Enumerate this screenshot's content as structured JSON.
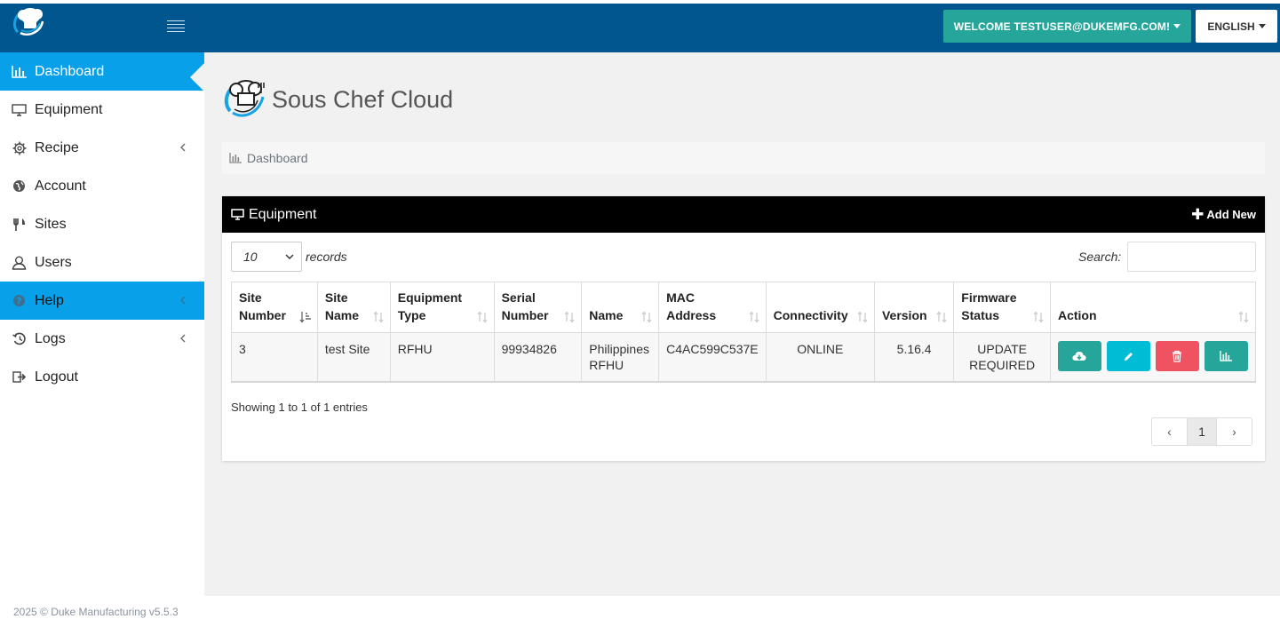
{
  "app": {
    "name": "Sous Chef Cloud"
  },
  "header": {
    "welcome_label": "WELCOME TESTUSER@DUKEMFG.COM!",
    "language_label": "ENGLISH"
  },
  "sidebar": {
    "items": [
      {
        "label": "Dashboard",
        "icon": "bar-chart-icon",
        "active": true
      },
      {
        "label": "Equipment",
        "icon": "monitor-icon"
      },
      {
        "label": "Recipe",
        "icon": "gear-icon",
        "submenu": true
      },
      {
        "label": "Account",
        "icon": "globe-icon"
      },
      {
        "label": "Sites",
        "icon": "utensils-icon"
      },
      {
        "label": "Users",
        "icon": "user-icon"
      },
      {
        "label": "Help",
        "icon": "question-icon",
        "submenu": true,
        "highlighted": true
      },
      {
        "label": "Logs",
        "icon": "history-icon",
        "submenu": true
      },
      {
        "label": "Logout",
        "icon": "sign-out-icon"
      }
    ]
  },
  "breadcrumb": {
    "label": "Dashboard"
  },
  "panel": {
    "title": "Equipment",
    "add_new_label": "Add New"
  },
  "table_controls": {
    "page_size": "10",
    "records_label": "records",
    "search_label": "Search:",
    "search_value": ""
  },
  "table": {
    "columns": [
      {
        "label": "Site Number",
        "sorted": "asc"
      },
      {
        "label": "Site Name"
      },
      {
        "label": "Equipment Type"
      },
      {
        "label": "Serial Number"
      },
      {
        "label": "Name"
      },
      {
        "label": "MAC Address"
      },
      {
        "label": "Connectivity"
      },
      {
        "label": "Version"
      },
      {
        "label": "Firmware Status"
      },
      {
        "label": "Action"
      }
    ],
    "rows": [
      {
        "site_number": "3",
        "site_name": "test Site",
        "equipment_type": "RFHU",
        "serial_number": "99934826",
        "name": "Philippines RFHU",
        "mac_address": "C4AC599C537E",
        "connectivity": "ONLINE",
        "version": "5.16.4",
        "firmware_status": "UPDATE REQUIRED"
      }
    ]
  },
  "pagination": {
    "info": "Showing 1 to 1 of 1 entries",
    "prev": "‹",
    "current_page": "1",
    "next": "›"
  },
  "footer": {
    "text": "2025 © Duke Manufacturing v5.5.3"
  },
  "colors": {
    "topbar": "#02568f",
    "accent_teal": "#26a69a",
    "sidebar_active": "#08a0e8",
    "online": "#1a8b1a",
    "update_required": "#e0141e",
    "btn_edit": "#00bcd4",
    "btn_delete": "#ef5361"
  }
}
